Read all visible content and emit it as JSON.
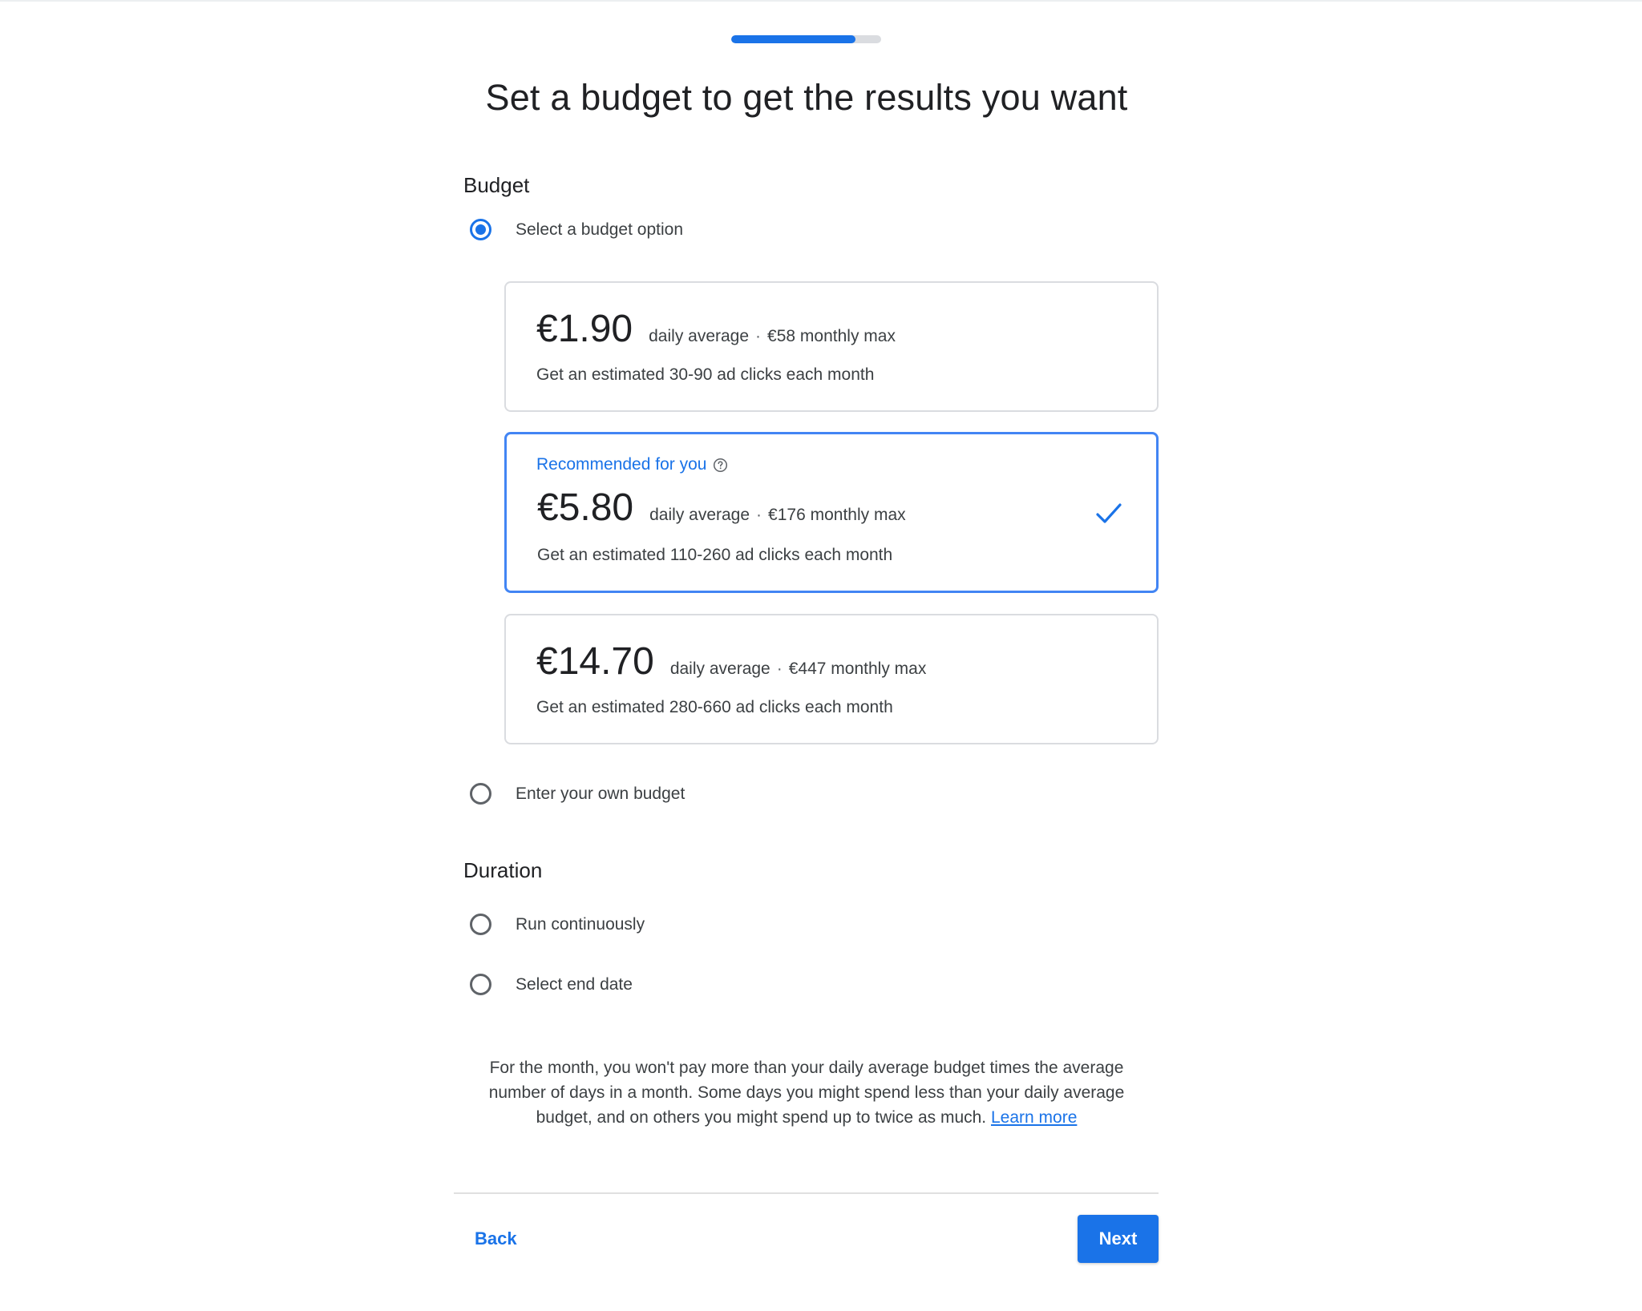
{
  "progress": {
    "fraction": 0.83
  },
  "title": "Set a budget to get the results you want",
  "budget": {
    "heading": "Budget",
    "select_option_label": "Select a budget option",
    "options": [
      {
        "recommended": false,
        "price": "€1.90",
        "daily_label": "daily average",
        "separator": "·",
        "monthly_max": "€58 monthly max",
        "estimate": "Get an estimated 30-90 ad clicks each month"
      },
      {
        "recommended": true,
        "recommended_label": "Recommended for you",
        "price": "€5.80",
        "daily_label": "daily average",
        "separator": "·",
        "monthly_max": "€176 monthly max",
        "estimate": "Get an estimated 110-260 ad clicks each month",
        "selected": true
      },
      {
        "recommended": false,
        "price": "€14.70",
        "daily_label": "daily average",
        "separator": "·",
        "monthly_max": "€447 monthly max",
        "estimate": "Get an estimated 280-660 ad clicks each month"
      }
    ],
    "own_budget_label": "Enter your own budget"
  },
  "duration": {
    "heading": "Duration",
    "run_continuously_label": "Run continuously",
    "end_date_label": "Select end date"
  },
  "note": {
    "text": "For the month, you won't pay more than your daily average budget times the average number of days in a month. Some days you might spend less than your daily average budget, and on others you might spend up to twice as much.",
    "link_text": "Learn more"
  },
  "footer": {
    "back_label": "Back",
    "next_label": "Next"
  },
  "colors": {
    "accent": "#1a73e8",
    "border": "#dadce0",
    "selected_border": "#4285f4"
  },
  "icons": {
    "help": "help-circle-icon",
    "check": "check-icon"
  }
}
